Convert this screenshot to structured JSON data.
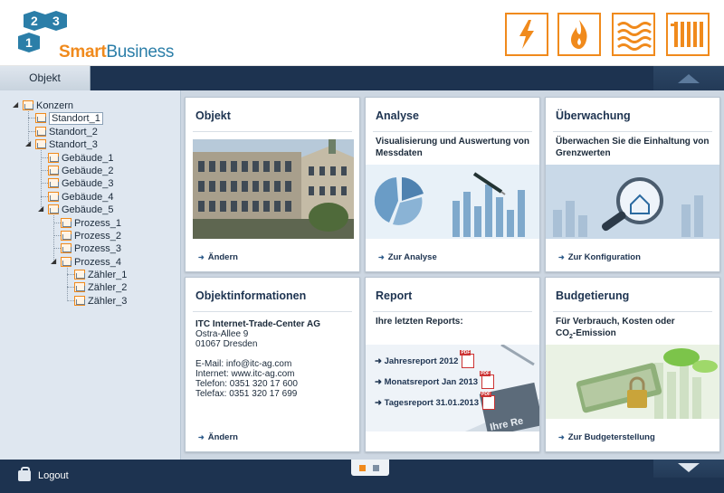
{
  "brand": {
    "logo_numbers": [
      "2",
      "3",
      "1"
    ],
    "name_part1": "Smart",
    "name_part2": "Business",
    "accent_color": "#f08a1c",
    "primary_color": "#1d3350"
  },
  "header": {
    "energy_icons": [
      "lightning-bolt-icon",
      "flame-icon",
      "waves-icon",
      "radiator-icon"
    ]
  },
  "tabs": [
    {
      "label": "Objekt",
      "active": true
    }
  ],
  "tree": [
    {
      "label": "Konzern",
      "level": 0,
      "expanded": true
    },
    {
      "label": "Standort_1",
      "level": 1,
      "selected": true
    },
    {
      "label": "Standort_2",
      "level": 1
    },
    {
      "label": "Standort_3",
      "level": 1,
      "expanded": true
    },
    {
      "label": "Gebäude_1",
      "level": 2
    },
    {
      "label": "Gebäude_2",
      "level": 2
    },
    {
      "label": "Gebäude_3",
      "level": 2
    },
    {
      "label": "Gebäude_4",
      "level": 2
    },
    {
      "label": "Gebäude_5",
      "level": 2,
      "expanded": true
    },
    {
      "label": "Prozess_1",
      "level": 3
    },
    {
      "label": "Prozess_2",
      "level": 3
    },
    {
      "label": "Prozess_3",
      "level": 3
    },
    {
      "label": "Prozess_4",
      "level": 3,
      "expanded": true
    },
    {
      "label": "Zähler_1",
      "level": 4
    },
    {
      "label": "Zähler_2",
      "level": 4
    },
    {
      "label": "Zähler_3",
      "level": 4
    }
  ],
  "cards": {
    "objekt": {
      "title": "Objekt",
      "link": "Ändern"
    },
    "analyse": {
      "title": "Analyse",
      "desc": "Visualisierung und Auswertung von Messdaten",
      "link": "Zur Analyse"
    },
    "ueberwachung": {
      "title": "Überwachung",
      "desc": "Überwachen Sie die Einhaltung von Grenzwerten",
      "link": "Zur Konfiguration"
    },
    "objektinfo": {
      "title": "Objektinformationen",
      "company": "ITC Internet-Trade-Center AG",
      "street": "Ostra-Allee 9",
      "city": "01067 Dresden",
      "email": "E-Mail: info@itc-ag.com",
      "internet": "Internet: www.itc-ag.com",
      "phone": "Telefon: 0351 320 17 600",
      "fax": "Telefax: 0351 320 17 699",
      "link": "Ändern"
    },
    "report": {
      "title": "Report",
      "desc": "Ihre letzten Reports:",
      "items": [
        "Jahresreport 2012",
        "Monatsreport Jan 2013",
        "Tagesreport 31.01.2013"
      ],
      "image_caption": "Ihre Re"
    },
    "budget": {
      "title": "Budgetierung",
      "desc_line1": "Für Verbrauch, Kosten oder",
      "desc_co2": "CO",
      "desc_sub": "2",
      "desc_rest": "-Emission",
      "link": "Zur Budgeterstellung"
    }
  },
  "footer": {
    "logout": "Logout",
    "pages": 2,
    "current_page": 1
  }
}
